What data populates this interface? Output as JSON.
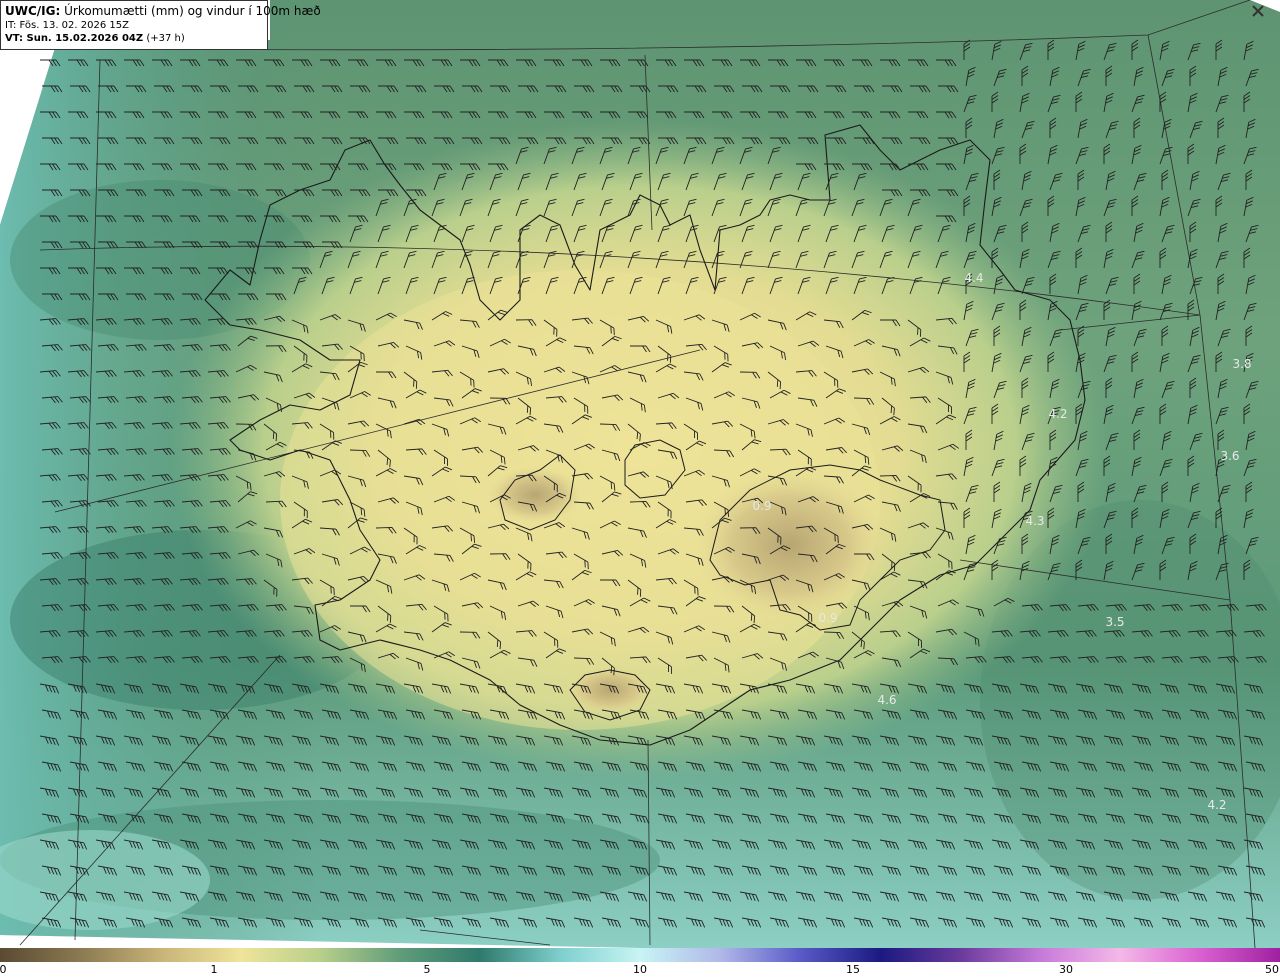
{
  "header": {
    "model": "UWC/IG:",
    "title": "Úrkomumætti (mm) og vindur í 100m hæð",
    "init_time": "IT: Fös. 13. 02. 2026 15Z",
    "valid_prefix": "VT: Sun. 15.02.2026 04Z",
    "valid_suffix": "(+37 h)"
  },
  "close_icon": "close-icon",
  "colorbar": {
    "ticks": [
      {
        "label": "0",
        "value": 0
      },
      {
        "label": "1",
        "value": 1
      },
      {
        "label": "5",
        "value": 5
      },
      {
        "label": "10",
        "value": 10
      },
      {
        "label": "15",
        "value": 15
      },
      {
        "label": "30",
        "value": 30
      },
      {
        "label": "50",
        "value": 50
      }
    ],
    "colors": [
      "#5a4a32",
      "#8b7a52",
      "#c7b377",
      "#efe49a",
      "#b8cf8a",
      "#5f9c79",
      "#2f7a6c",
      "#7fcfcf",
      "#c8f4f4",
      "#b0b8e8",
      "#5a5ac8",
      "#1a1a80",
      "#6a3a9c",
      "#c67ad8",
      "#f4b8e8",
      "#d860d0",
      "#a020a0"
    ]
  },
  "map_labels": [
    {
      "text": "4.4"
    },
    {
      "text": "3.8"
    },
    {
      "text": "4.2"
    },
    {
      "text": "3.6"
    },
    {
      "text": "4.3"
    },
    {
      "text": "3.5"
    },
    {
      "text": "4.6"
    },
    {
      "text": "4.2"
    },
    {
      "text": "0.9"
    },
    {
      "text": "0.9"
    }
  ],
  "colors": {
    "dry": "#efe49a",
    "mid": "#6a9c78",
    "wet": "#3d7f6e",
    "coast": "#1a1a1a"
  }
}
